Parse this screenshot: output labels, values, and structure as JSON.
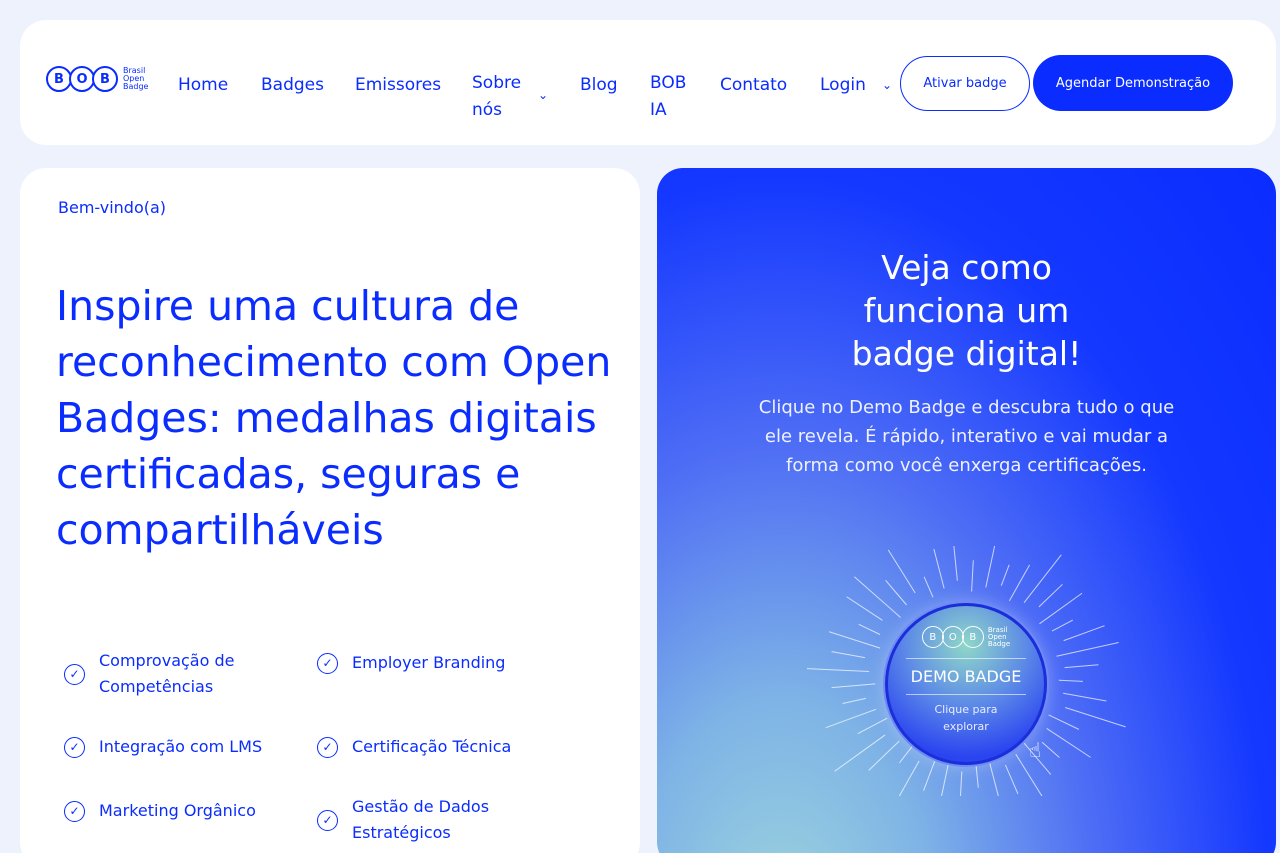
{
  "nav": {
    "logo": {
      "letters": [
        "B",
        "O",
        "B"
      ],
      "text_lines": [
        "Brasil",
        "Open",
        "Badge"
      ]
    },
    "items": [
      {
        "label": "Home"
      },
      {
        "label": "Badges"
      },
      {
        "label": "Emissores"
      },
      {
        "label": "Sobre nós",
        "line1": "Sobre",
        "line2": "nós",
        "has_dropdown": true
      },
      {
        "label": "Blog"
      },
      {
        "label": "BOB IA",
        "line1": "BOB",
        "line2": "IA"
      },
      {
        "label": "Contato"
      },
      {
        "label": "Login",
        "has_dropdown": true
      }
    ],
    "dropdown_icon": "chevron-down-icon",
    "activate_button": "Ativar badge",
    "demo_button": "Agendar Demonstração"
  },
  "hero": {
    "welcome": "Bem-vindo(a)",
    "headline": "Inspire uma cultura de reconhecimento com Open Badges: medalhas digitais certificadas, seguras e compartilháveis",
    "features": [
      {
        "label": "Comprovação de Competências",
        "icon": "check-circle-icon"
      },
      {
        "label": "Employer Branding",
        "icon": "check-circle-icon"
      },
      {
        "label": "Integração com LMS",
        "icon": "check-circle-icon"
      },
      {
        "label": "Certificação Técnica",
        "icon": "check-circle-icon"
      },
      {
        "label": "Marketing Orgânico",
        "icon": "check-circle-icon"
      },
      {
        "label": "Gestão de Dados Estratégicos",
        "icon": "check-circle-icon"
      }
    ]
  },
  "demo": {
    "title": "Veja como funciona um badge digital!",
    "subtitle": "Clique no Demo Badge e descubra tudo o que ele revela. É rápido, interativo e vai mudar a forma como você enxerga certificações.",
    "badge": {
      "logo_letters": [
        "B",
        "O",
        "B"
      ],
      "logo_text": [
        "Brasil",
        "Open",
        "Badge"
      ],
      "title": "DEMO BADGE",
      "cta": "Clique para explorar"
    },
    "cursor_icon": "hand-pointer-icon"
  },
  "colors": {
    "brand_blue": "#0a2cff",
    "page_bg": "#eef2fd",
    "card_bg": "#ffffff"
  }
}
